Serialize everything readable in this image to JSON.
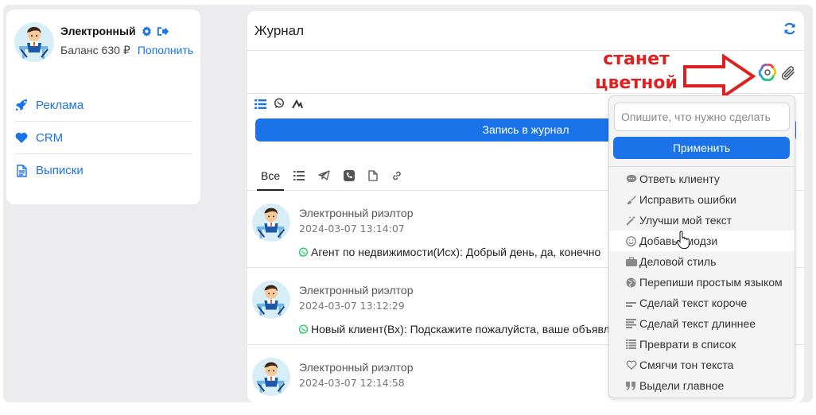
{
  "sidebar": {
    "user_name": "Электронный",
    "balance_label": "Баланс 630",
    "currency": "₽",
    "topup_label": "Пополнить",
    "nav": [
      {
        "label": "Реклама",
        "icon": "rocket-icon"
      },
      {
        "label": "CRM",
        "icon": "heart-icon"
      },
      {
        "label": "Выписки",
        "icon": "document-icon"
      }
    ]
  },
  "journal": {
    "title": "Журнал",
    "submit_label": "Запись в журнал",
    "composer_icons": [
      "list-icon",
      "whatsapp-icon",
      "avito-icon"
    ],
    "filters": [
      {
        "label": "Все",
        "active": true
      },
      {
        "icon": "list-icon"
      },
      {
        "icon": "telegram-icon"
      },
      {
        "icon": "phone-icon"
      },
      {
        "icon": "file-icon"
      },
      {
        "icon": "link-icon"
      }
    ],
    "entries": [
      {
        "author": "Электронный риэлтор",
        "time": "2024-03-07 13:14:07",
        "text": "Агент по недвижимости(Исх): Добрый день, да, конечно"
      },
      {
        "author": "Электронный риэлтор",
        "time": "2024-03-07 13:12:29",
        "text": "Новый клиент(Вх): Подскажите пожалуйста, ваше объявл"
      },
      {
        "author": "Электронный риэлтор",
        "time": "2024-03-07 12:14:58",
        "text": ""
      }
    ]
  },
  "annotation": {
    "line1": "станет",
    "line2": "цветной",
    "color": "#e02020"
  },
  "ai_menu": {
    "placeholder": "Опишите, что нужно сделать",
    "apply_label": "Применить",
    "items": [
      {
        "label": "Ответь клиенту",
        "icon": "chat-icon"
      },
      {
        "label": "Исправить ошибки",
        "icon": "brush-icon"
      },
      {
        "label": "Улучши мой текст",
        "icon": "magic-wand-icon"
      },
      {
        "label": "Добавь эмодзи",
        "icon": "smile-icon"
      },
      {
        "label": "Деловой стиль",
        "icon": "briefcase-icon"
      },
      {
        "label": "Перепиши простым языком",
        "icon": "globe-icon"
      },
      {
        "label": "Сделай текст короче",
        "icon": "short-lines-icon"
      },
      {
        "label": "Сделай текст длиннее",
        "icon": "long-lines-icon"
      },
      {
        "label": "Преврати в список",
        "icon": "list-icon"
      },
      {
        "label": "Смягчи тон текста",
        "icon": "heart-outline-icon"
      },
      {
        "label": "Выдели главное",
        "icon": "quote-icon"
      }
    ]
  },
  "colors": {
    "accent": "#1a73e8",
    "whatsapp": "#25d366",
    "annotation": "#e02020"
  }
}
